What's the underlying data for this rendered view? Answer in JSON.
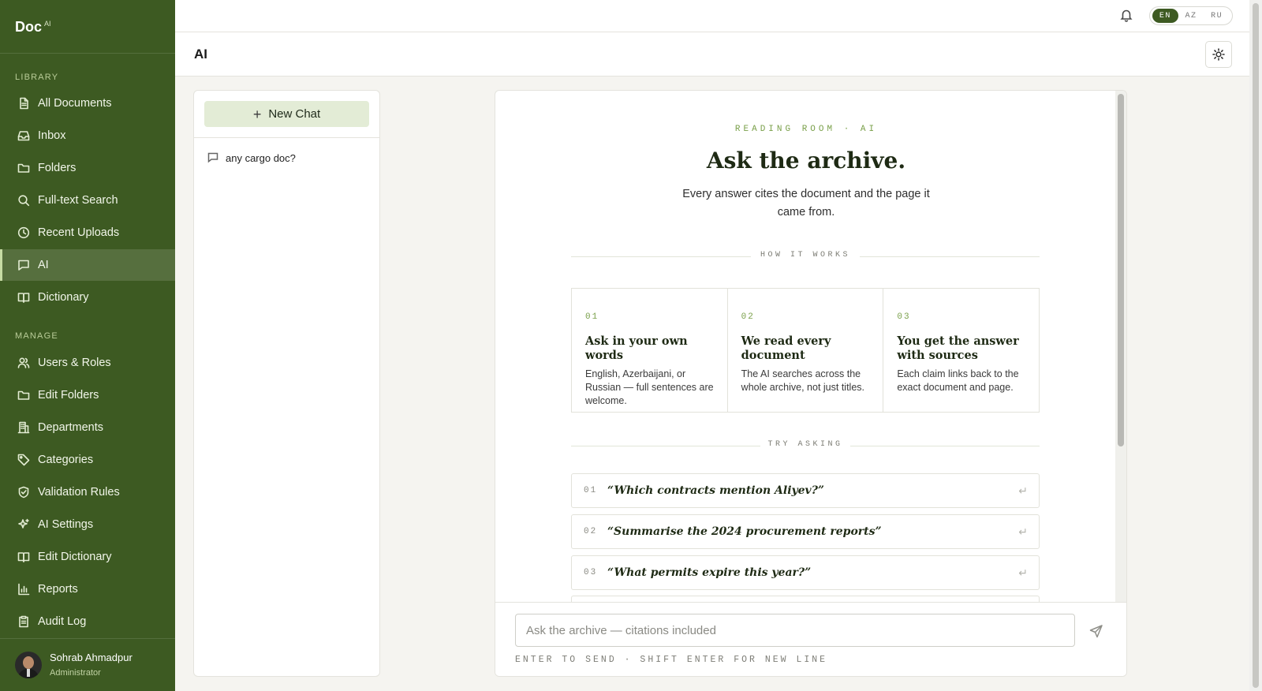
{
  "brand": {
    "name": "Doc",
    "sup": "AI"
  },
  "sidebar": {
    "library_label": "LIBRARY",
    "manage_label": "MANAGE",
    "library": [
      {
        "label": "All Documents",
        "icon": "document-icon"
      },
      {
        "label": "Inbox",
        "icon": "inbox-icon"
      },
      {
        "label": "Folders",
        "icon": "folder-icon"
      },
      {
        "label": "Full-text Search",
        "icon": "search-icon"
      },
      {
        "label": "Recent Uploads",
        "icon": "clock-icon"
      },
      {
        "label": "AI",
        "icon": "chat-icon",
        "active": true
      },
      {
        "label": "Dictionary",
        "icon": "book-icon"
      }
    ],
    "manage": [
      {
        "label": "Users & Roles",
        "icon": "users-icon"
      },
      {
        "label": "Edit Folders",
        "icon": "folder-icon"
      },
      {
        "label": "Departments",
        "icon": "building-icon"
      },
      {
        "label": "Categories",
        "icon": "tag-icon"
      },
      {
        "label": "Validation Rules",
        "icon": "shield-check-icon"
      },
      {
        "label": "AI Settings",
        "icon": "sparkle-icon"
      },
      {
        "label": "Edit Dictionary",
        "icon": "book-icon"
      },
      {
        "label": "Reports",
        "icon": "bar-chart-icon"
      },
      {
        "label": "Audit Log",
        "icon": "clipboard-icon"
      }
    ],
    "user": {
      "name": "Sohrab Ahmadpur",
      "role": "Administrator"
    }
  },
  "header": {
    "languages": [
      "EN",
      "AZ",
      "RU"
    ],
    "selected_language": "EN",
    "page_title": "AI"
  },
  "chats": {
    "new_chat_label": "New Chat",
    "items": [
      "any cargo doc?"
    ]
  },
  "room": {
    "eyebrow": "READING ROOM · AI",
    "headline": "Ask the archive.",
    "lede": "Every answer cites the document and the page it came from.",
    "how_label": "HOW IT WORKS",
    "steps": [
      {
        "num": "01",
        "title": "Ask in your own words",
        "desc": "English, Azerbaijani, or Russian — full sentences are welcome."
      },
      {
        "num": "02",
        "title": "We read every document",
        "desc": "The AI searches across the whole archive, not just titles."
      },
      {
        "num": "03",
        "title": "You get the answer with sources",
        "desc": "Each claim links back to the exact document and page."
      }
    ],
    "try_label": "TRY ASKING",
    "prompts": [
      {
        "num": "01",
        "text": "“Which contracts mention Aliyev?”"
      },
      {
        "num": "02",
        "text": "“Summarise the 2024 procurement reports”"
      },
      {
        "num": "03",
        "text": "“What permits expire this year?”"
      }
    ]
  },
  "composer": {
    "placeholder": "Ask the archive — citations included",
    "value": "",
    "hint": "ENTER TO SEND · SHIFT ENTER FOR NEW LINE"
  },
  "colors": {
    "sidebar": "#3d5a22",
    "accent": "#7aa04a",
    "new_chat_bg": "#e3ecd6"
  }
}
